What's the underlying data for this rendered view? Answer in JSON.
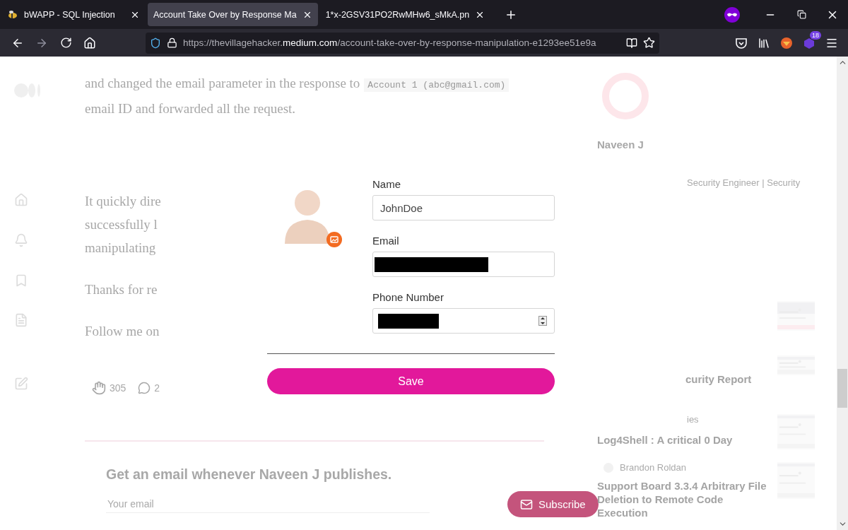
{
  "browser": {
    "tabs": [
      {
        "title": "bWAPP - SQL Injection",
        "selected": false
      },
      {
        "title": "Account Take Over by Response Ma",
        "selected": true
      },
      {
        "title": "1*x-2GSV31PO2RwMHw6_sMkA.pn",
        "selected": false
      }
    ],
    "nav_buttons": [
      {
        "kind": "back",
        "disabled": false
      },
      {
        "kind": "forward",
        "disabled": true
      },
      {
        "kind": "reload",
        "disabled": false
      },
      {
        "kind": "home",
        "disabled": false
      }
    ],
    "address": {
      "prefix": "https://thevillagehacker.",
      "domain": "medium.com",
      "path": "/account-take-over-by-response-manipulation-e1293ee51e9a"
    },
    "extension_badge": "18"
  },
  "article": {
    "intro": {
      "text": "and changed the email parameter in the response to",
      "code": "Account 1 (abc@gmail.com)",
      "tail": "email ID and forwarded all the request."
    },
    "paragraphs": [
      [
        "It quickly dire",
        "successfully l",
        "manipulating"
      ],
      [
        "Thanks for re"
      ],
      [
        "Follow me on"
      ]
    ],
    "reactions": {
      "claps": "305",
      "responses": "2"
    },
    "subscribe": {
      "heading": "Get an email whenever Naveen J publishes.",
      "placeholder": "Your email",
      "button": "Subscribe"
    }
  },
  "sidebar": {
    "author": "Naveen J",
    "bio": "Security Engineer | Security",
    "report_title": "curity Report",
    "cut_label": "ies",
    "log4shell_title": "Log4Shell : A critical 0 Day",
    "story_author": "Brandon Roldan",
    "story_title": "Support Board 3.3.4 Arbitrary File Deletion to Remote Code Execution"
  },
  "lightbox": {
    "fields": [
      {
        "label": "Name",
        "kind": "text",
        "value": "JohnDoe"
      },
      {
        "label": "Email",
        "kind": "redacted"
      },
      {
        "label": "Phone Number",
        "kind": "number_redacted"
      }
    ],
    "button": "Save"
  }
}
